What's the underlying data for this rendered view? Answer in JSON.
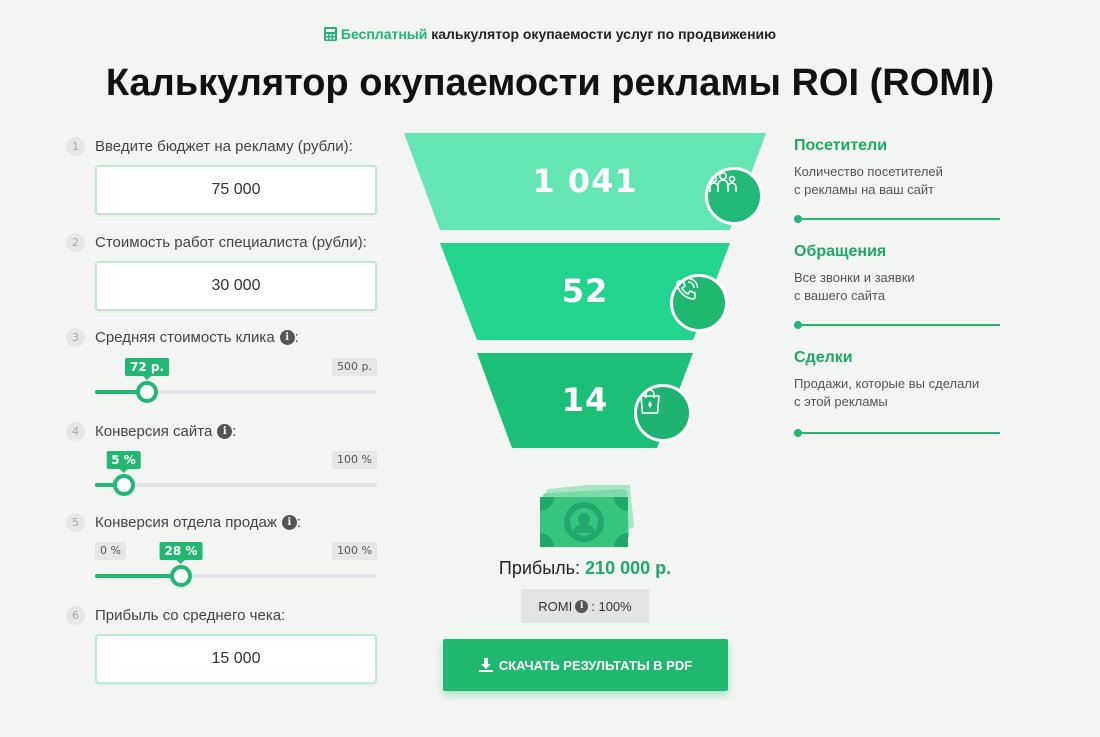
{
  "header": {
    "tag_highlight": "Бесплатный",
    "tag_rest": "калькулятор окупаемости услуг по продвижению",
    "title": "Калькулятор окупаемости рекламы ROI (ROMI)"
  },
  "steps": [
    {
      "num": "1",
      "label": "Введите бюджет на рекламу (рубли):",
      "value": "75 000"
    },
    {
      "num": "2",
      "label": "Стоимость работ специалиста (рубли):",
      "value": "30 000"
    },
    {
      "num": "3",
      "label": "Средняя стоимость клика",
      "value_label": "72 р.",
      "max_label": "500 р.",
      "fraction": 0.144
    },
    {
      "num": "4",
      "label": "Конверсия сайта",
      "value_label": "5 %",
      "max_label": "100 %",
      "fraction": 0.05
    },
    {
      "num": "5",
      "label": "Конверсия отдела продаж",
      "min_label": "0 %",
      "value_label": "28 %",
      "max_label": "100 %",
      "fraction": 0.28
    },
    {
      "num": "6",
      "label": "Прибыль со среднего чека:",
      "value": "15 000"
    }
  ],
  "funnel": [
    {
      "value": "1 041",
      "icon": "visitors-icon",
      "color": "#63e5b4"
    },
    {
      "value": "52",
      "icon": "phone-icon",
      "color": "#23d48f"
    },
    {
      "value": "14",
      "icon": "shopping-bag-icon",
      "color": "#1cbf78"
    }
  ],
  "legend": [
    {
      "title": "Посетители",
      "desc1": "Количество посетителей",
      "desc2": "с рекламы на ваш сайт"
    },
    {
      "title": "Обращения",
      "desc1": "Все звонки и заявки",
      "desc2": "с вашего сайта"
    },
    {
      "title": "Сделки",
      "desc1": "Продажи, которые вы сделали",
      "desc2": "с этой рекламы"
    }
  ],
  "result": {
    "profit_label": "Прибыль:",
    "profit_value": "210 000 р.",
    "romi_label": "ROMI",
    "romi_value": ": 100%",
    "download_label": "СКАЧАТЬ РЕЗУЛЬТАТЫ В PDF"
  },
  "colors": {
    "accent": "#20b771",
    "input_border": "#bfe9d3"
  }
}
